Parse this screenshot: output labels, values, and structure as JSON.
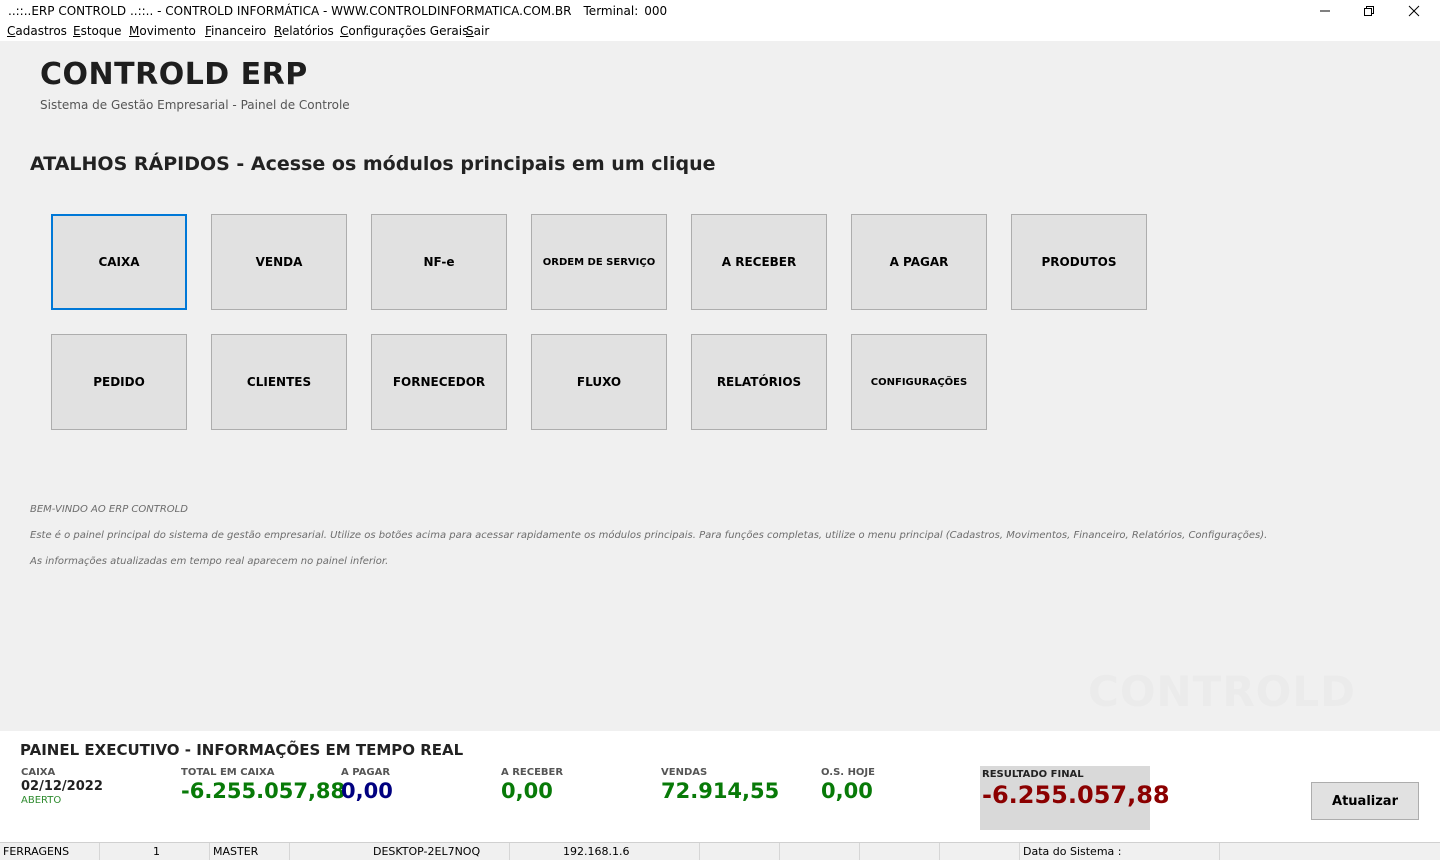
{
  "window": {
    "title": "..::..ERP CONTROLD ..::.. - CONTROLD INFORMÁTICA - WWW.CONTROLDINFORMATICA.COM.BR",
    "terminal_label": "Terminal:",
    "terminal_value": "000",
    "controls": [
      "minimize-icon",
      "restore-icon",
      "close-icon"
    ]
  },
  "menu": [
    {
      "acc": "C",
      "rest": "adastros"
    },
    {
      "acc": "E",
      "rest": "stoque"
    },
    {
      "acc": "M",
      "rest": "ovimento"
    },
    {
      "acc": "F",
      "rest": "inanceiro"
    },
    {
      "acc": "R",
      "rest": "elatórios"
    },
    {
      "acc": "C",
      "rest": "onfigurações Gerais"
    },
    {
      "acc": "S",
      "rest": "air"
    }
  ],
  "header": {
    "title": "CONTROLD ERP",
    "subtitle": "Sistema de Gestão Empresarial - Painel de Controle"
  },
  "shortcuts": {
    "title": "ATALHOS RÁPIDOS - Acesse os módulos principais em um clique",
    "row1": [
      "CAIXA",
      "VENDA",
      "NF-e",
      "ORDEM DE SERVIÇO",
      "A RECEBER",
      "A PAGAR",
      "PRODUTOS"
    ],
    "row2": [
      "PEDIDO",
      "CLIENTES",
      "FORNECEDOR",
      "FLUXO",
      "RELATÓRIOS",
      "CONFIGURAÇÕES"
    ]
  },
  "info": {
    "welcome": "BEM-VINDO AO ERP CONTROLD",
    "line1": "Este é o painel principal do sistema de gestão empresarial. Utilize os botões acima para acessar rapidamente os módulos principais. Para funções completas, utilize o menu principal (Cadastros, Movimentos, Financeiro, Relatórios, Configurações).",
    "line2": "As informações atualizadas em tempo real aparecem no painel inferior.",
    "watermark": "CONTROLD"
  },
  "exec_panel": {
    "title": "PAINEL EXECUTIVO - INFORMAÇÕES EM TEMPO REAL",
    "caixa": {
      "label": "CAIXA",
      "date": "02/12/2022",
      "status": "ABERTO"
    },
    "total_caixa": {
      "label": "TOTAL EM CAIXA",
      "value": "-6.255.057,88"
    },
    "a_pagar": {
      "label": "A PAGAR",
      "value": "0,00"
    },
    "a_receber": {
      "label": "A RECEBER",
      "value": "0,00"
    },
    "vendas": {
      "label": "VENDAS",
      "value": "72.914,55"
    },
    "os_hoje": {
      "label": "O.S. HOJE",
      "value": "0,00"
    },
    "resultado": {
      "label": "RESULTADO FINAL",
      "value": "-6.255.057,88"
    },
    "refresh_label": "Atualizar",
    "colors": {
      "green": "#087a08",
      "navy": "#000080",
      "darkred": "#8b0000"
    }
  },
  "statusbar": {
    "company": "FERRAGENS",
    "number": "1",
    "user": "MASTER",
    "computer": "DESKTOP-2EL7NOQ",
    "ip": "192.168.1.6",
    "date_label": "Data do Sistema :"
  }
}
